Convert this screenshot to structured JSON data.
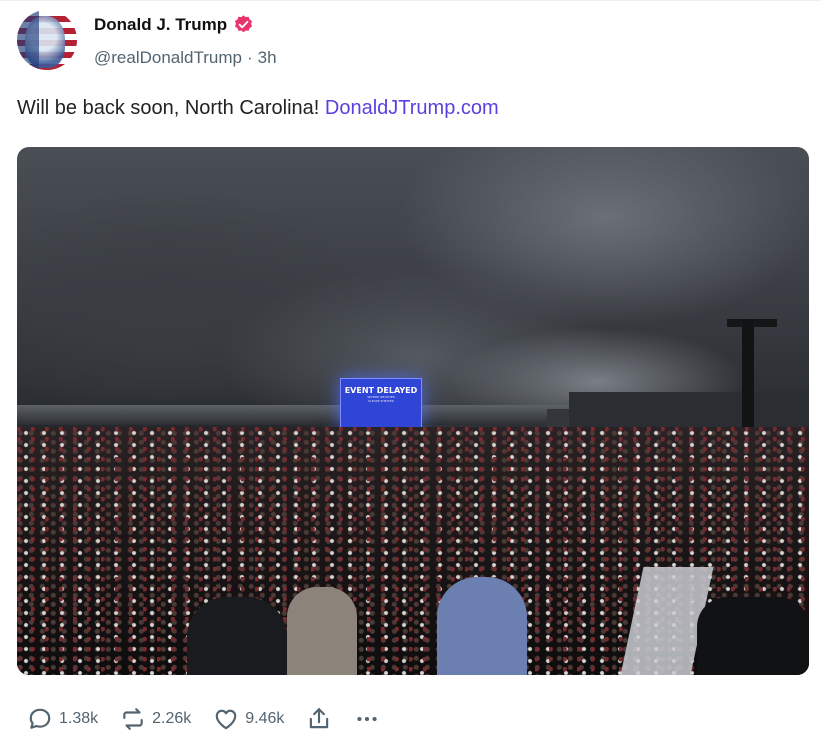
{
  "post": {
    "author": {
      "name": "Donald J. Trump",
      "handle": "@realDonaldTrump",
      "separator": "·",
      "time": "3h",
      "verified": true
    },
    "text": "Will be back soon, North Carolina!",
    "link_text": "DonaldJTrump.com",
    "media": {
      "screen_title": "EVENT DELAYED",
      "screen_fine_print_1": "SEVERE WEATHER",
      "screen_fine_print_2": "PLEASE SHELTER"
    },
    "actions": {
      "replies": "1.38k",
      "reposts": "2.26k",
      "likes": "9.46k"
    }
  },
  "colors": {
    "link": "#5b3fe0",
    "verified_badge": "#e8346b",
    "muted_text": "#536471"
  },
  "icons": [
    "verified-badge-icon",
    "reply-icon",
    "repost-icon",
    "heart-icon",
    "share-icon",
    "more-icon"
  ]
}
